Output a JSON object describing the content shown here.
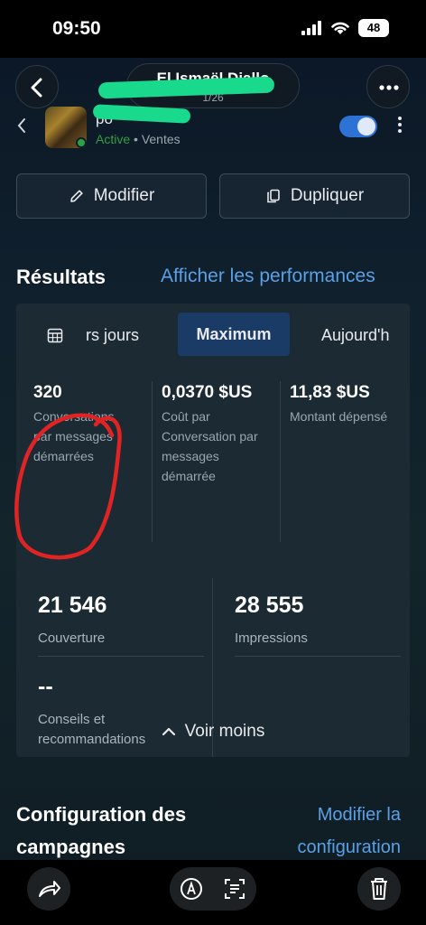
{
  "status_bar": {
    "time": "09:50",
    "battery": "48"
  },
  "header": {
    "account_name": "El Ismaël Diallo",
    "date_fragment": "1/26"
  },
  "ad": {
    "name_fragment": "po",
    "status_active": "Active",
    "status_sep": " • ",
    "objective": "Ventes"
  },
  "actions": {
    "edit_label": "Modifier",
    "duplicate_label": "Dupliquer"
  },
  "results": {
    "title": "Résultats",
    "performance_link": "Afficher les performances",
    "tabs": {
      "previous": "rs jours",
      "active": "Maximum",
      "next": "Aujourd'h"
    },
    "metrics": [
      {
        "value": "320",
        "label": "Conversations par messages démarrées"
      },
      {
        "value": "0,0370 $US",
        "label": "Coût par Conversation par messages démarrée"
      },
      {
        "value": "11,83 $US",
        "label": "Montant dépensé"
      }
    ],
    "reach": {
      "value": "21 546",
      "label": "Couverture"
    },
    "impressions": {
      "value": "28 555",
      "label": "Impressions"
    },
    "tips": {
      "value": "--",
      "label": "Conseils et recommandations"
    },
    "see_less": "Voir moins"
  },
  "configuration": {
    "title": "Configuration des campagnes",
    "edit_link": "Modifier la configuration"
  },
  "colors": {
    "accent": "#5aa0e6",
    "active_green": "#2ea043",
    "toggle_blue": "#2f72d6",
    "selected_tab": "#1a3b66",
    "annotation_red": "#e02424",
    "redaction_green": "#19d98c"
  },
  "icons": [
    "chevron-left-icon",
    "more-horizontal-icon",
    "pencil-icon",
    "duplicate-icon",
    "calendar-icon",
    "chevron-up-icon",
    "share-icon",
    "markup-icon",
    "text-scan-icon",
    "trash-icon"
  ]
}
